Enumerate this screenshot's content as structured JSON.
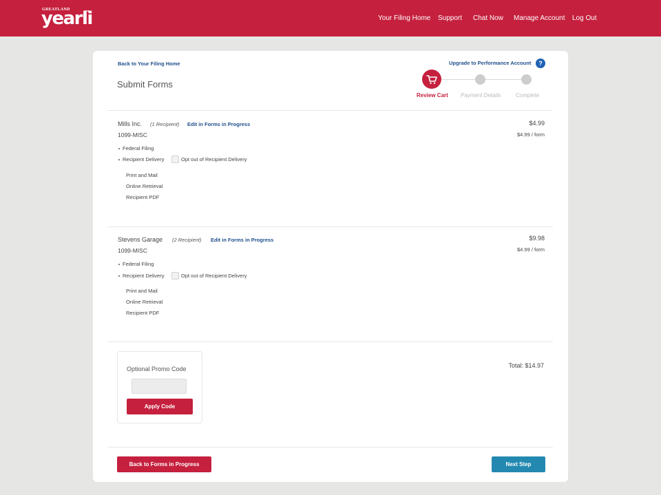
{
  "header": {
    "logo_small": "GREATLAND",
    "logo_main": "yearli",
    "nav": [
      "Your Filing Home",
      "Support",
      "Chat Now",
      "Manage Account",
      "Log Out"
    ]
  },
  "page": {
    "back_link": "Back to Your Filing Home",
    "upgrade_link": "Upgrade to Performance Account",
    "help_symbol": "?",
    "title": "Submit Forms"
  },
  "steps": [
    {
      "label": "Review Cart",
      "active": true
    },
    {
      "label": "Payment Details",
      "active": false
    },
    {
      "label": "Complete",
      "active": false
    }
  ],
  "orders": [
    {
      "company": "Mills Inc.",
      "recipients": "(1 Recipient)",
      "edit_link": "Edit in Forms in Progress",
      "form_type": "1099-MISC",
      "price": "$4.99",
      "per_form": "$4.99 / form",
      "federal": "Federal Filing",
      "delivery": "Recipient Delivery",
      "opt_out": "Opt out of Recipient Delivery",
      "options": [
        "Print and Mail",
        "Online Retrieval",
        "Recipient PDF"
      ]
    },
    {
      "company": "Stevens Garage",
      "recipients": "(2 Recipient)",
      "edit_link": "Edit in Forms in Progress",
      "form_type": "1099-MISC",
      "price": "$9.98",
      "per_form": "$4.99 / form",
      "federal": "Federal Filing",
      "delivery": "Recipient Delivery",
      "opt_out": "Opt out of Recipient Delivery",
      "options": [
        "Print and Mail",
        "Online Retrieval",
        "Recipient PDF"
      ]
    }
  ],
  "promo": {
    "title": "Optional Promo Code",
    "input_value": "",
    "apply_label": "Apply Code"
  },
  "total": "Total: $14.97",
  "footer": {
    "back_label": "Back to Forms in Progress",
    "next_label": "Next Step"
  },
  "colors": {
    "brand_red": "#c5203e",
    "link_blue": "#1f4e8c",
    "next_teal": "#2489b0"
  }
}
